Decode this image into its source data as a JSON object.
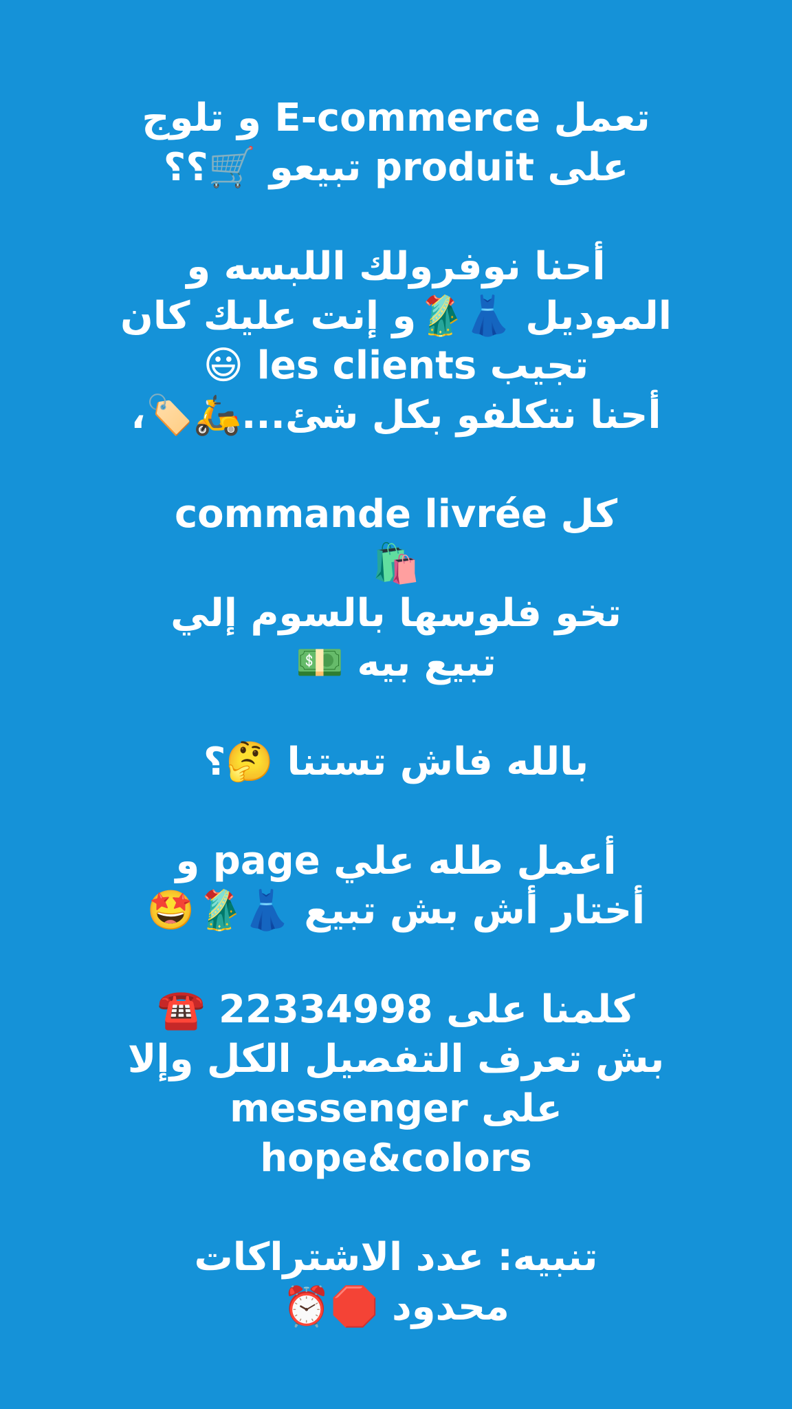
{
  "story": {
    "lines": [
      "تعمل E-commerce و تلوج",
      "على produit تبيعو 🛒؟؟",
      "أحنا نوفرولك اللبسه و",
      "الموديل 👗🥻و إنت عليك كان",
      "تجيب les clients 😃",
      "أحنا نتكلفو بكل شئ...🛵🏷️،",
      "كل commande livrée",
      "🛍️",
      "تخو فلوسها بالسوم إلي",
      "تبيع بيه 💵",
      "بالله فاش تستنا 🤔؟",
      "أعمل طله علي page و",
      "أختار أش بش تبيع 👗🥻🤩",
      "كلمنا على 22334998 ☎️",
      "بش تعرف التفصيل الكل وإلا",
      "على messenger",
      "hope&colors",
      "تنبيه: عدد الاشتراكات",
      "محدود 🛑⏰"
    ]
  },
  "colors": {
    "background": "#1592d8",
    "text": "#ffffff"
  }
}
